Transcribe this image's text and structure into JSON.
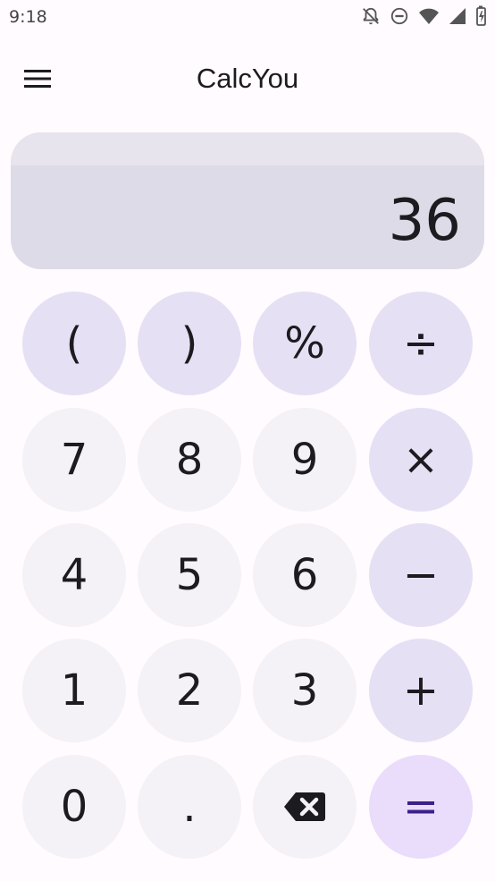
{
  "status_bar": {
    "time": "9:18"
  },
  "app_bar": {
    "title": "CalcYou"
  },
  "display": {
    "value": "36"
  },
  "keys": {
    "open_paren": "(",
    "close_paren": ")",
    "percent": "%",
    "divide": "÷",
    "seven": "7",
    "eight": "8",
    "nine": "9",
    "multiply": "×",
    "four": "4",
    "five": "5",
    "six": "6",
    "minus": "−",
    "one": "1",
    "two": "2",
    "three": "3",
    "plus": "+",
    "zero": "0",
    "decimal": ".",
    "backspace_icon": "backspace-icon",
    "equals": "="
  },
  "colors": {
    "background": "#fffbfe",
    "display": "#dedbe8",
    "number_key": "#f4f1f7",
    "operator_key": "#e6e0f5",
    "equals_key": "#eadcfb",
    "equals_text": "#3b1f8a"
  }
}
